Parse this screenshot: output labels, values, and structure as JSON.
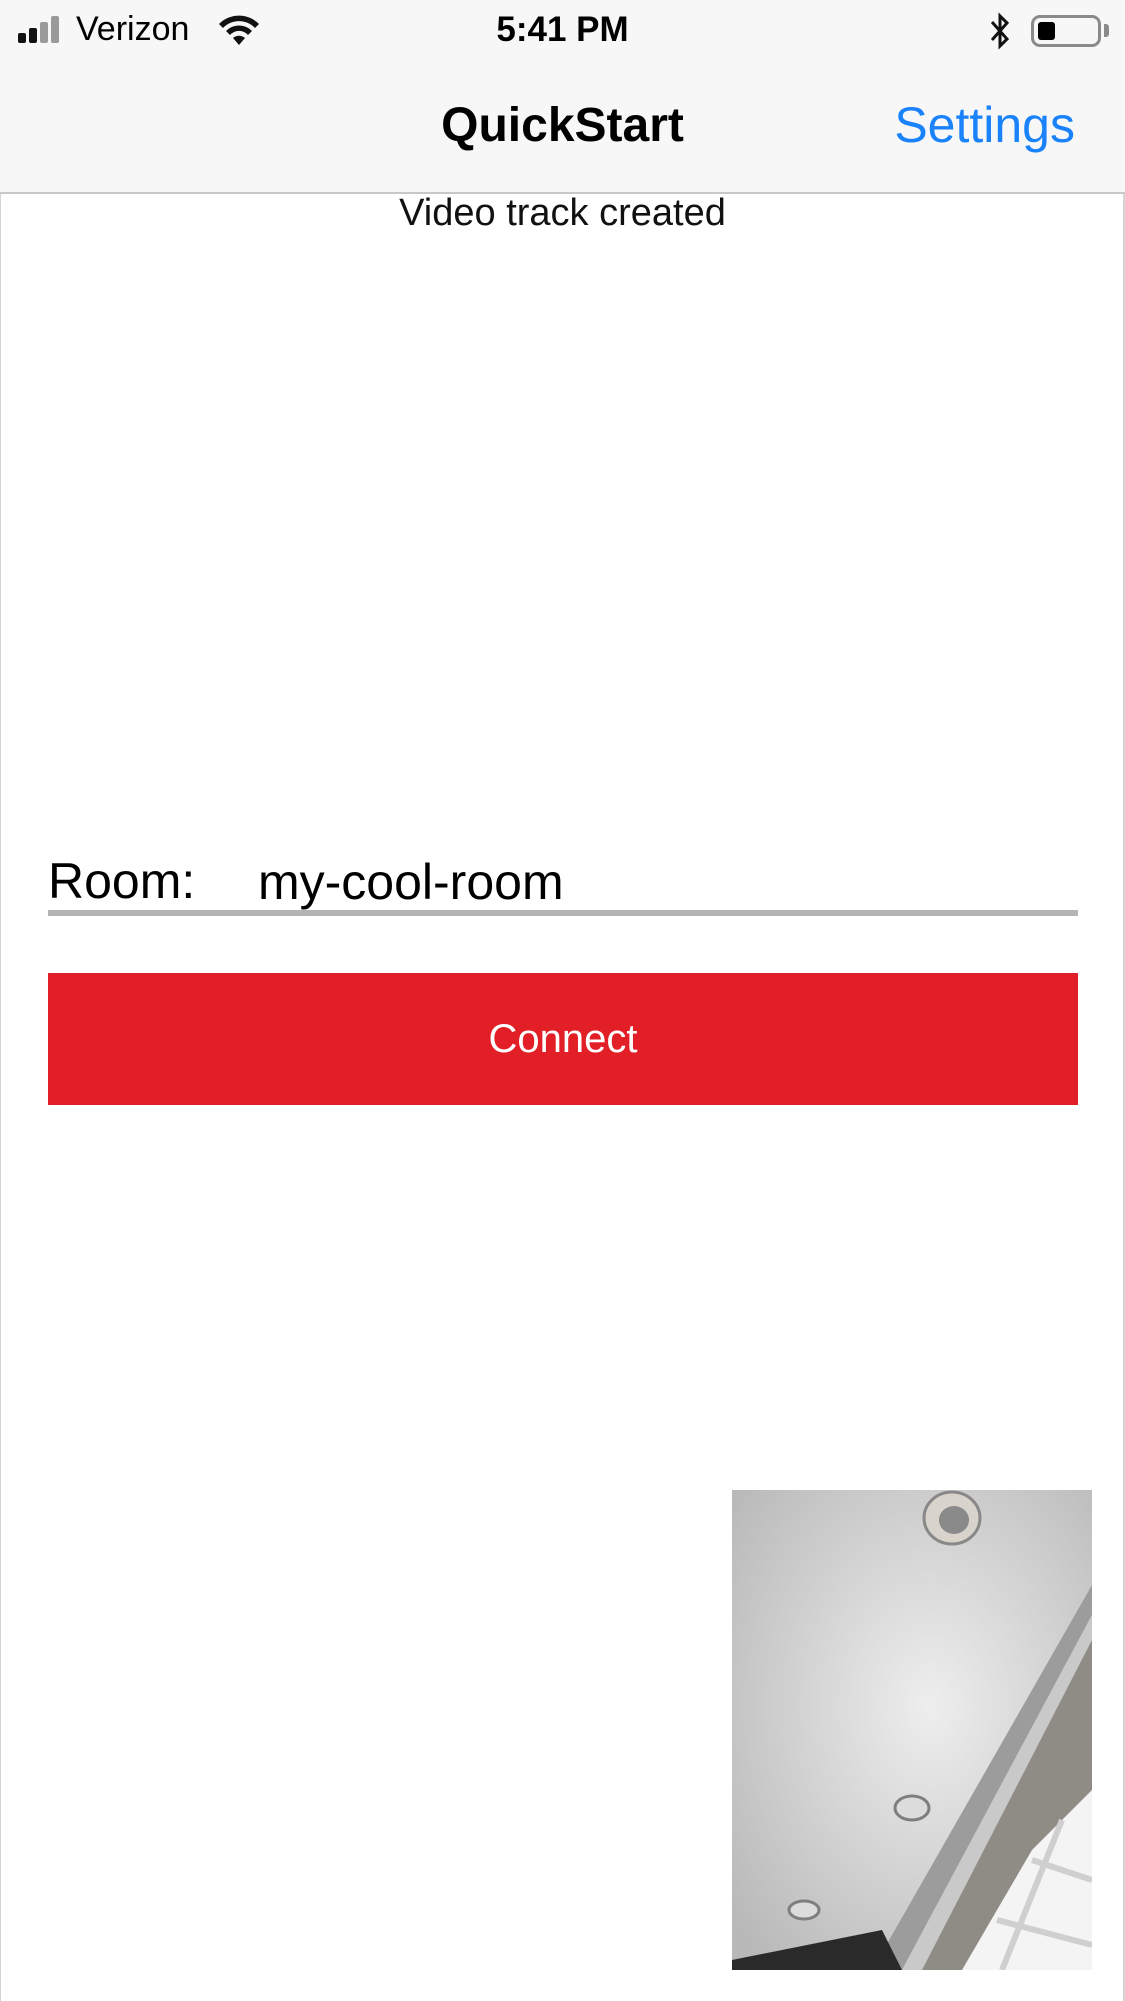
{
  "status_bar": {
    "carrier": "Verizon",
    "time": "5:41 PM",
    "signal_bars": 2,
    "battery_level_fraction": 0.3
  },
  "nav": {
    "title": "QuickStart",
    "settings_label": "Settings"
  },
  "message": "Video track created",
  "room": {
    "label": "Room:",
    "value": "my-cool-room"
  },
  "connect_label": "Connect",
  "colors": {
    "accent_blue": "#1a82fb",
    "connect_red": "#e21e26",
    "nav_background": "#f7f7f7"
  },
  "icons": [
    "cellular-signal-icon",
    "wifi-icon",
    "bluetooth-icon",
    "battery-icon"
  ]
}
